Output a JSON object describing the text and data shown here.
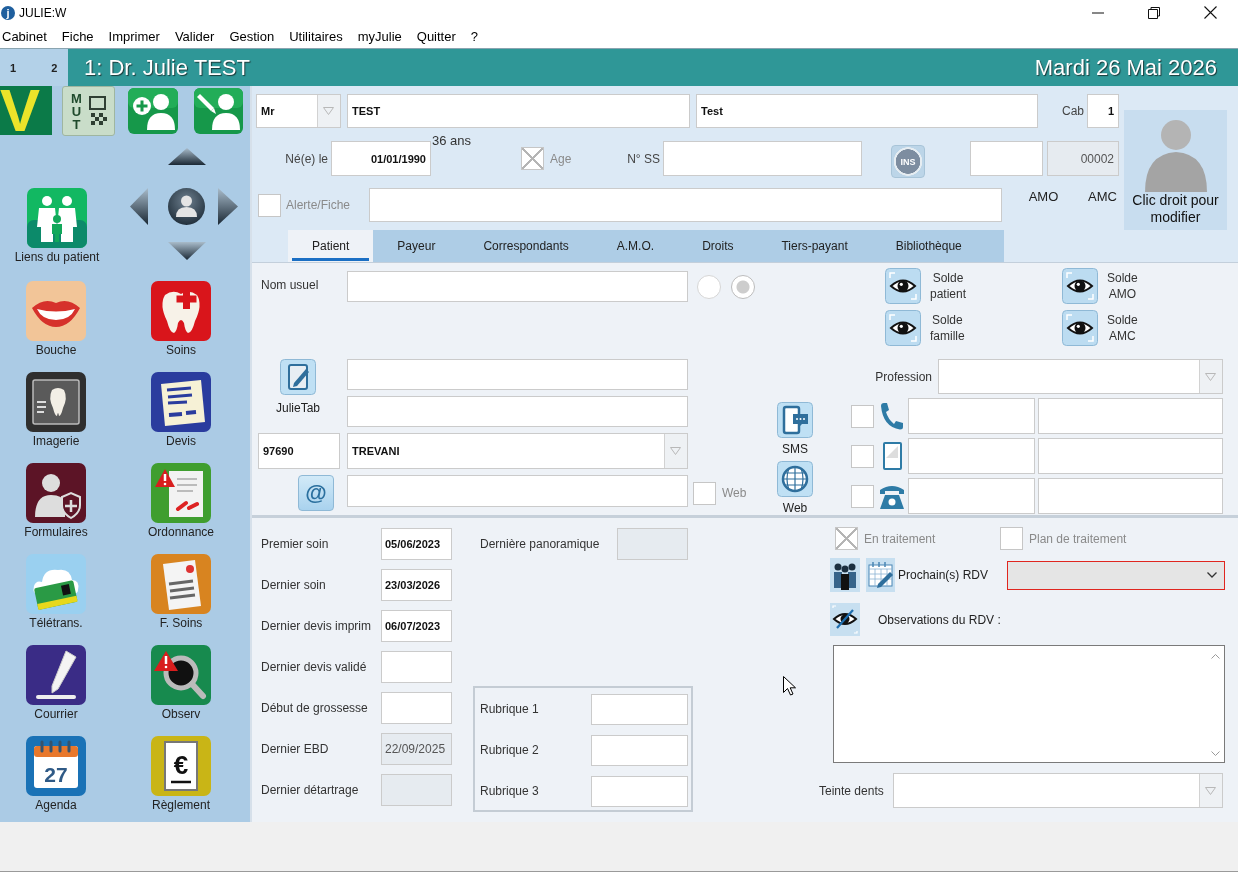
{
  "window": {
    "icon_letter": "j",
    "title": "JULIE:W"
  },
  "menu": [
    "Cabinet",
    "Fiche",
    "Imprimer",
    "Valider",
    "Gestion",
    "Utilitaires",
    "myJulie",
    "Quitter",
    "?"
  ],
  "header": {
    "workspaces": [
      "1",
      "2"
    ],
    "practitioner": "1: Dr. Julie TEST",
    "date": "Mardi 26 Mai 2026"
  },
  "sidebar": {
    "vitale_button": {
      "text": "V"
    },
    "mutual_button": {
      "text": "MUT"
    },
    "patient_links": {
      "label": "Liens du patient"
    },
    "modules": [
      {
        "label": "Bouche"
      },
      {
        "label": "Soins"
      },
      {
        "label": "Imagerie"
      },
      {
        "label": "Devis"
      },
      {
        "label": "Formulaires"
      },
      {
        "label": "Ordonnance"
      },
      {
        "label": "Télétrans."
      },
      {
        "label": "F. Soins"
      },
      {
        "label": "Courrier"
      },
      {
        "label": "Observ"
      },
      {
        "label": "Agenda"
      },
      {
        "label": "Règlement"
      }
    ],
    "agenda_icon_day": "27",
    "payment_icon_symbol": "€"
  },
  "identity": {
    "civility": "Mr",
    "last_name": "TEST",
    "first_name": "Test",
    "cabinet": {
      "label": "Cab",
      "value": "1"
    },
    "birth_date": {
      "label": "Né(e) le",
      "value": "01/01/1990"
    },
    "age": "36 ans",
    "age_checkbox": {
      "label": "Age",
      "checked": true,
      "disabled": true
    },
    "ss_number": {
      "label": "N° SS"
    },
    "ins_button": {
      "text": "INS"
    },
    "number_fields": [
      {
        "disabled": false
      },
      {
        "value": "00002",
        "disabled": true
      }
    ],
    "alert": {
      "label": "Alerte/Fiche",
      "checked": false,
      "disabled": true
    },
    "coverage_labels": [
      "AMO",
      "AMC"
    ],
    "photo": {
      "caption": "Clic droit pour modifier"
    }
  },
  "tabs": [
    {
      "label": "Patient",
      "selected": true
    },
    {
      "label": "Payeur",
      "selected": false
    },
    {
      "label": "Correspondants",
      "selected": false
    },
    {
      "label": "A.M.O.",
      "selected": false
    },
    {
      "label": "Droits",
      "selected": false
    },
    {
      "label": "Tiers-payant",
      "selected": false
    },
    {
      "label": "Bibliothèque",
      "selected": false
    }
  ],
  "patient_tab": {
    "usual_name": {
      "label": "Nom usuel"
    },
    "name_radios": [
      {
        "selected": false
      },
      {
        "selected": true
      }
    ],
    "balances": [
      {
        "label": "Solde patient"
      },
      {
        "label": "Solde AMO"
      },
      {
        "label": "Solde famille"
      },
      {
        "label": "Solde AMC"
      }
    ],
    "julietab_button": {
      "label": "JulieTab"
    },
    "postal_code": "97690",
    "city": "TREVANI",
    "email_button": {
      "text": "@"
    },
    "web_checkbox": {
      "label": "Web",
      "checked": false,
      "disabled": true
    },
    "contact_buttons": [
      {
        "label": "SMS"
      },
      {
        "label": "Web"
      }
    ],
    "profession": {
      "label": "Profession"
    },
    "phones": [
      {
        "checked": false
      },
      {
        "checked": false
      },
      {
        "checked": false
      }
    ]
  },
  "history": {
    "dates": [
      {
        "label": "Premier soin",
        "value": "05/06/2023",
        "disabled": false
      },
      {
        "label": "Dernier soin",
        "value": "23/03/2026",
        "disabled": false
      },
      {
        "label": "Dernier devis imprim",
        "value": "06/07/2023",
        "disabled": false
      },
      {
        "label": "Dernier devis validé",
        "disabled": false
      },
      {
        "label": "Début de grossesse",
        "disabled": false
      },
      {
        "label": "Dernier EBD",
        "value": "22/09/2025",
        "disabled": true
      },
      {
        "label": "Dernier détartrage",
        "disabled": true
      }
    ],
    "panoramic": {
      "label": "Dernière panoramique",
      "disabled": true
    },
    "custom_fields": [
      {
        "label": "Rubrique 1"
      },
      {
        "label": "Rubrique 2"
      },
      {
        "label": "Rubrique 3"
      }
    ]
  },
  "appointments": {
    "checkboxes": [
      {
        "label": "En traitement",
        "checked": true,
        "disabled": true
      },
      {
        "label": "Plan de traitement",
        "checked": false,
        "disabled": true
      }
    ],
    "next_label": "Prochain(s) RDV",
    "next_select": {
      "highlighted": true
    },
    "notes_label": "Observations du RDV :",
    "shade": {
      "label": "Teinte dents"
    }
  }
}
